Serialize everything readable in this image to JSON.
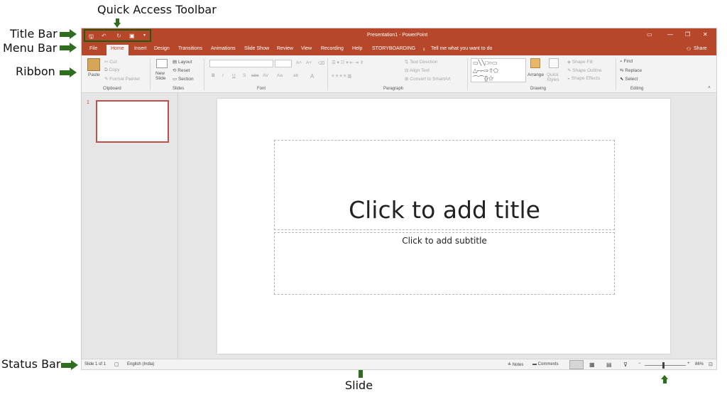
{
  "annotations": {
    "quick_access": "Quick Access Toolbar",
    "title_bar": "Title Bar",
    "menu_bar": "Menu Bar",
    "ribbon": "Ribbon",
    "status_bar": "Status Bar",
    "slide": "Slide"
  },
  "window": {
    "title": "Presentation1 - PowerPoint",
    "share": "Share"
  },
  "menu": {
    "tabs": [
      "File",
      "Home",
      "Insert",
      "Design",
      "Transitions",
      "Animations",
      "Slide Show",
      "Review",
      "View",
      "Recording",
      "Help",
      "STORYBOARDING"
    ],
    "tell_me": "Tell me what you want to do"
  },
  "ribbon": {
    "clipboard": {
      "label": "Clipboard",
      "paste": "Paste",
      "cut": "Cut",
      "copy": "Copy",
      "format_painter": "Format Painter"
    },
    "slides": {
      "label": "Slides",
      "new_slide": "New Slide",
      "layout": "Layout",
      "reset": "Reset",
      "section": "Section"
    },
    "font": {
      "label": "Font",
      "bold": "B",
      "italic": "I",
      "underline": "U",
      "shadow": "S",
      "strike": "abc",
      "spacing": "AV",
      "case": "Aa",
      "color": "A"
    },
    "paragraph": {
      "label": "Paragraph",
      "text_direction": "Text Direction",
      "align_text": "Align Text",
      "convert": "Convert to SmartArt"
    },
    "drawing": {
      "label": "Drawing",
      "arrange": "Arrange",
      "quick_styles": "Quick Styles",
      "shape_fill": "Shape Fill",
      "shape_outline": "Shape Outline",
      "shape_effects": "Shape Effects"
    },
    "editing": {
      "label": "Editing",
      "find": "Find",
      "replace": "Replace",
      "select": "Select"
    }
  },
  "thumbnails": {
    "number": "1"
  },
  "slide": {
    "title_placeholder": "Click to add title",
    "subtitle_placeholder": "Click to add subtitle"
  },
  "status": {
    "slide_count": "Slide 1 of 1",
    "language": "English (India)",
    "notes": "Notes",
    "comments": "Comments",
    "zoom": "86%",
    "zoom_fraction": 0.45
  },
  "colors": {
    "accent": "#b7472a",
    "annotation_arrow": "#2f6d1f"
  }
}
